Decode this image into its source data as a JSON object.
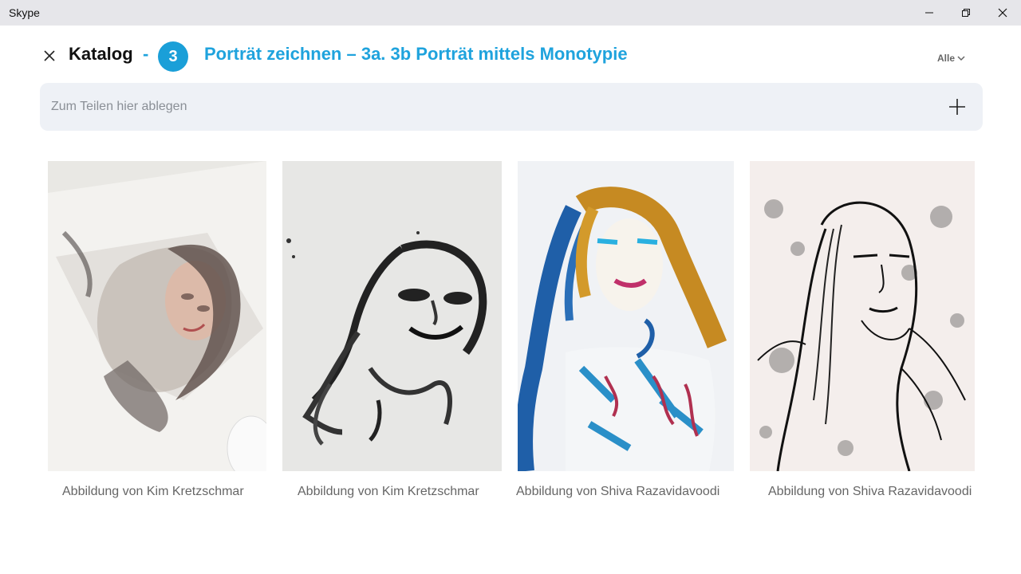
{
  "window": {
    "title": "Skype"
  },
  "header": {
    "title": "Katalog",
    "separator": "-",
    "badge_number": "3",
    "subtitle": "Porträt zeichnen – 3a. 3b Porträt mittels Monotypie",
    "filter_label": "Alle"
  },
  "dropzone": {
    "placeholder": "Zum Teilen hier ablegen"
  },
  "gallery": [
    {
      "caption": "Abbildung  von Kim  Kretzschmar"
    },
    {
      "caption": "Abbildung  von Kim  Kretzschmar"
    },
    {
      "caption": "Abbildung  von Shiva Razavidavoodi"
    },
    {
      "caption": "Abbildung  von Shiva Razavidavoodi"
    }
  ],
  "colors": {
    "accent": "#1a9fd8",
    "dropzone_bg": "#eef1f6",
    "titlebar_bg": "#e6e6ea"
  }
}
